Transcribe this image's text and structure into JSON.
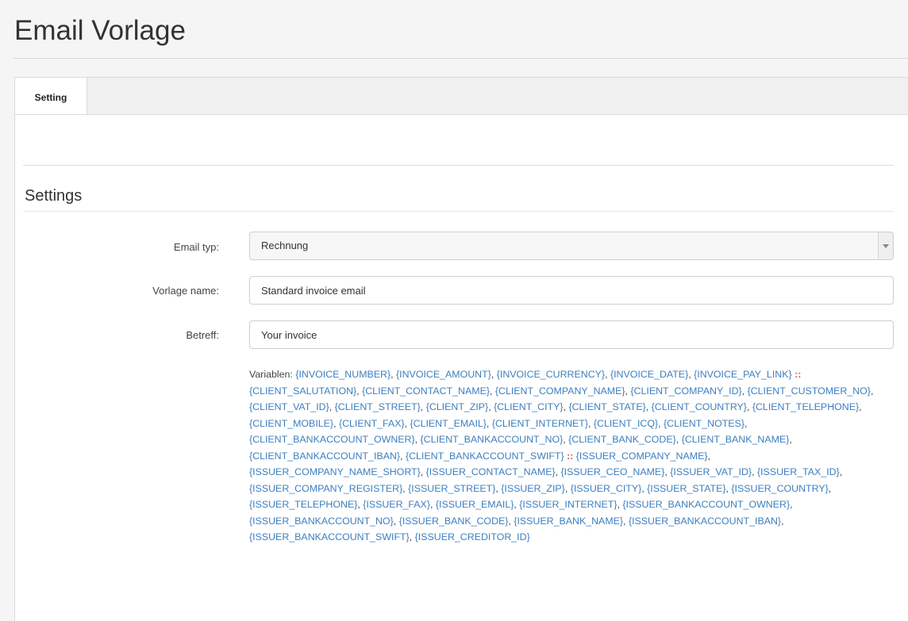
{
  "page": {
    "title": "Email Vorlage"
  },
  "tabs": [
    {
      "label": "Setting"
    }
  ],
  "section": {
    "title": "Settings"
  },
  "form": {
    "email_type": {
      "label": "Email typ:",
      "value": "Rechnung"
    },
    "template_name": {
      "label": "Vorlage name:",
      "value": "Standard invoice email"
    },
    "subject": {
      "label": "Betreff:",
      "value": "Your invoice"
    }
  },
  "variables": {
    "prefix": "Variablen:",
    "separator": "::",
    "invoice": [
      "{INVOICE_NUMBER}",
      "{INVOICE_AMOUNT}",
      "{INVOICE_CURRENCY}",
      "{INVOICE_DATE}",
      "{INVOICE_PAY_LINK}"
    ],
    "client": [
      "{CLIENT_SALUTATION}",
      "{CLIENT_CONTACT_NAME}",
      "{CLIENT_COMPANY_NAME}",
      "{CLIENT_COMPANY_ID}",
      "{CLIENT_CUSTOMER_NO}",
      "{CLIENT_VAT_ID}",
      "{CLIENT_STREET}",
      "{CLIENT_ZIP}",
      "{CLIENT_CITY}",
      "{CLIENT_STATE}",
      "{CLIENT_COUNTRY}",
      "{CLIENT_TELEPHONE}",
      "{CLIENT_MOBILE}",
      "{CLIENT_FAX}",
      "{CLIENT_EMAIL}",
      "{CLIENT_INTERNET}",
      "{CLIENT_ICQ}",
      "{CLIENT_NOTES}",
      "{CLIENT_BANKACCOUNT_OWNER}",
      "{CLIENT_BANKACCOUNT_NO}",
      "{CLIENT_BANK_CODE}",
      "{CLIENT_BANK_NAME}",
      "{CLIENT_BANKACCOUNT_IBAN}",
      "{CLIENT_BANKACCOUNT_SWIFT}"
    ],
    "issuer": [
      "{ISSUER_COMPANY_NAME}",
      "{ISSUER_COMPANY_NAME_SHORT}",
      "{ISSUER_CONTACT_NAME}",
      "{ISSUER_CEO_NAME}",
      "{ISSUER_VAT_ID}",
      "{ISSUER_TAX_ID}",
      "{ISSUER_COMPANY_REGISTER}",
      "{ISSUER_STREET}",
      "{ISSUER_ZIP}",
      "{ISSUER_CITY}",
      "{ISSUER_STATE}",
      "{ISSUER_COUNTRY}",
      "{ISSUER_TELEPHONE}",
      "{ISSUER_FAX}",
      "{ISSUER_EMAIL}",
      "{ISSUER_INTERNET}",
      "{ISSUER_BANKACCOUNT_OWNER}",
      "{ISSUER_BANKACCOUNT_NO}",
      "{ISSUER_BANK_CODE}",
      "{ISSUER_BANK_NAME}",
      "{ISSUER_BANKACCOUNT_IBAN}",
      "{ISSUER_BANKACCOUNT_SWIFT}",
      "{ISSUER_CREDITOR_ID}"
    ]
  }
}
